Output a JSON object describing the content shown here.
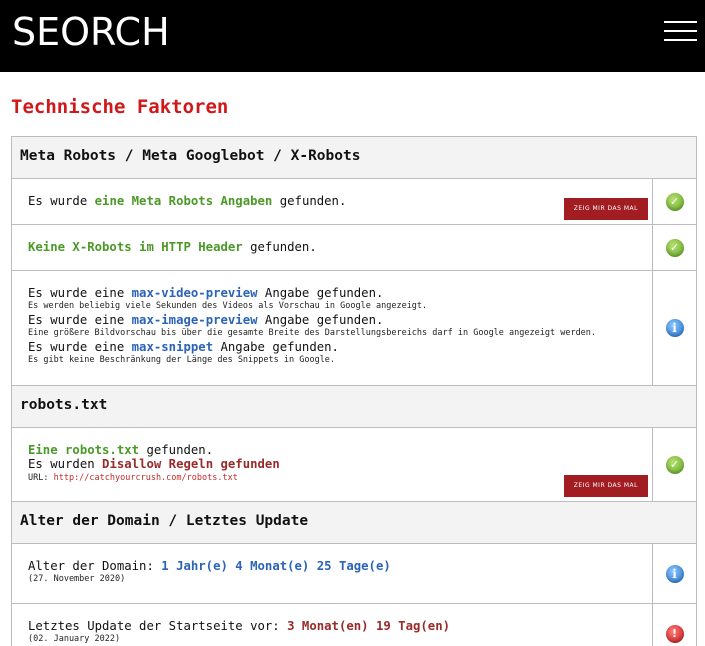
{
  "header": {
    "logo": "SEORCH"
  },
  "page": {
    "title": "Technische Faktoren"
  },
  "labels": {
    "show_button": "ZEIG MIR DAS MAL"
  },
  "colors": {
    "accent_red": "#d0181b",
    "green": "#4b9a27",
    "blue": "#2a63b8",
    "header_bg": "#000000"
  },
  "sections": {
    "meta": {
      "title": "Meta Robots / Meta Googlebot / X-Robots",
      "row1": {
        "pre": "Es wurde ",
        "highlight": "eine Meta Robots Angaben",
        "post": " gefunden.",
        "status": "check-icon"
      },
      "row2": {
        "highlight": "Keine X-Robots im HTTP Header",
        "post": " gefunden.",
        "status": "check-icon"
      },
      "row3": {
        "pre": "Es wurde eine ",
        "post": " Angabe gefunden.",
        "items": [
          {
            "name": "max-video-preview",
            "desc": "Es werden beliebig viele Sekunden des Videos als Vorschau in Google angezeigt."
          },
          {
            "name": "max-image-preview",
            "desc": "Eine größere Bildvorschau bis über die gesamte Breite des Darstellungsbereichs darf in Google angezeigt werden."
          },
          {
            "name": "max-snippet",
            "desc": "Es gibt keine Beschränkung der Länge des Snippets in Google."
          }
        ],
        "status": "info-icon"
      }
    },
    "robots": {
      "title": "robots.txt",
      "row1": {
        "highlight": "Eine robots.txt",
        "post": " gefunden.",
        "line2_pre": "Es wurden ",
        "line2_highlight": "Disallow Regeln gefunden",
        "url_label": "URL: ",
        "url": "http://catchyourcrush.com/robots.txt",
        "status": "check-icon"
      }
    },
    "domain": {
      "title": "Alter der Domain / Letztes Update",
      "row1": {
        "pre": "Alter der Domain: ",
        "highlight": "1 Jahr(e) 4 Monat(e) 25 Tage(e)",
        "date": "(27. November 2020)",
        "status": "info-icon"
      },
      "row2": {
        "pre": "Letztes Update der Startseite vor: ",
        "highlight": "3 Monat(en) 19 Tag(en)",
        "date": "(02. January 2022)",
        "status": "error-icon"
      }
    }
  }
}
